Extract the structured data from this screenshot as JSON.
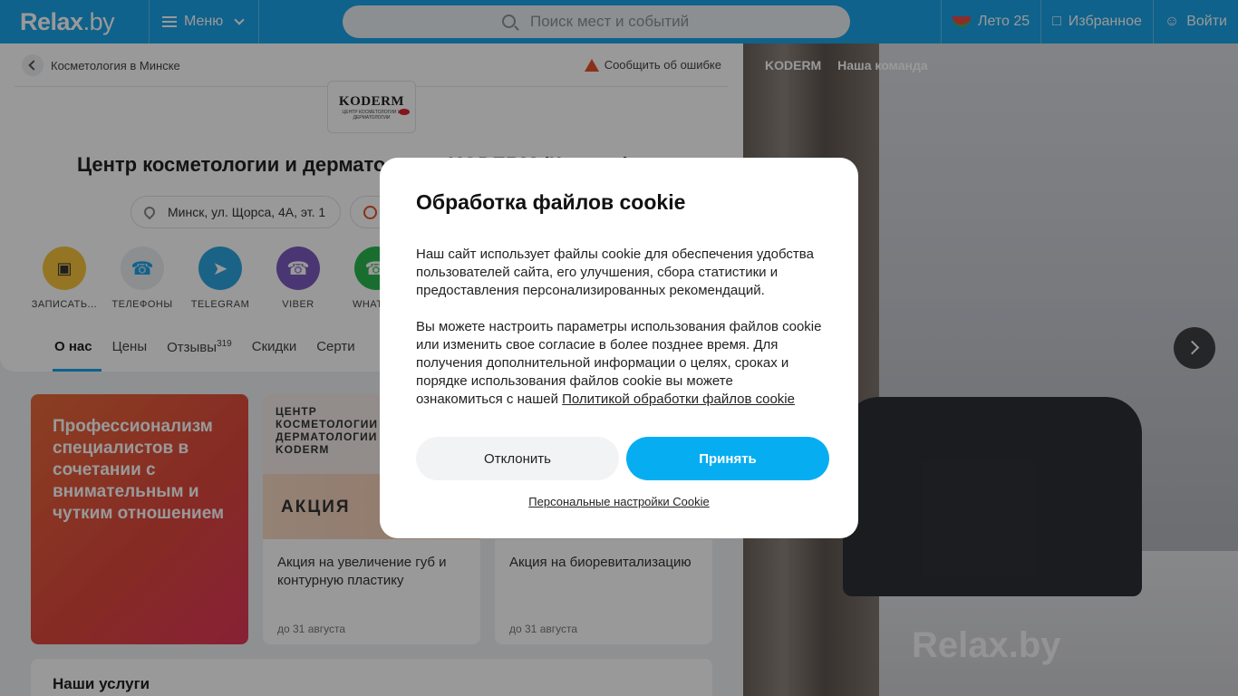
{
  "header": {
    "logo_main": "Relax",
    "logo_dot": ".by",
    "menu_label": "Меню",
    "search_placeholder": "Поиск мест и событий",
    "summer_label": "Лето 25",
    "favorites_label": "Избранное",
    "login_label": "Войти"
  },
  "breadcrumb": {
    "label": "Косметология в Минске"
  },
  "report_label": "Сообщить об ошибке",
  "brand": {
    "name": "KODERM",
    "subtitle": "ЦЕНТР КОСМЕТОЛОГИИ И ДЕРМАТОЛОГИИ"
  },
  "page_title": "Центр косметологии и дерматологии KODERM (Кодерм)",
  "address": "Минск, ул. Щорса, 4А, эт. 1",
  "actions": [
    {
      "label": "ЗАПИСАТЬ...",
      "color": "#f5c43d",
      "icon": "calendar-icon"
    },
    {
      "label": "ТЕЛЕФОНЫ",
      "color": "#e9edf0",
      "icon": "phone-icon"
    },
    {
      "label": "TELEGRAM",
      "color": "#2ea6e0",
      "icon": "telegram-icon"
    },
    {
      "label": "VIBER",
      "color": "#7a5bbf",
      "icon": "viber-icon"
    },
    {
      "label": "WHATS...",
      "color": "#2ab84f",
      "icon": "whatsapp-icon"
    }
  ],
  "tabs": {
    "about": "О нас",
    "prices": "Цены",
    "reviews": "Отзывы",
    "reviews_count": "319",
    "discounts": "Скидки",
    "certificates": "Серти"
  },
  "promo_text": "Профессионализм специалистов в сочетании с внимательным и чутким отношением",
  "deals": [
    {
      "header": "ЦЕНТР КОСМЕТОЛОГИИ И ДЕРМАТОЛОГИИ KODERM",
      "badge": "АКЦИЯ",
      "title": "Акция на увеличение губ и контурную пластику",
      "date": "до 31 августа"
    },
    {
      "header": "",
      "badge": "",
      "title": "Акция на биоревитализацию",
      "date": "до 31 августа"
    }
  ],
  "services_title": "Наши услуги",
  "gallery": {
    "tab1": "KODERM",
    "tab2": "Наша команда",
    "watermark": "Relax.by"
  },
  "cookie": {
    "title": "Обработка файлов cookie",
    "para1": "Наш сайт использует файлы cookie для обеспечения удобства пользователей сайта, его улучшения, сбора статистики и предоставления персонализированных рекомендаций.",
    "para2": "Вы можете настроить параметры использования файлов cookie или изменить свое согласие в более позднее время. Для получения дополнительной информации о целях, сроках и порядке использования файлов cookie вы можете ознакомиться с нашей",
    "policy_link": "Политикой обработки файлов cookie",
    "decline": "Отклонить",
    "accept": "Принять",
    "personal": "Персональные настройки Cookie"
  }
}
